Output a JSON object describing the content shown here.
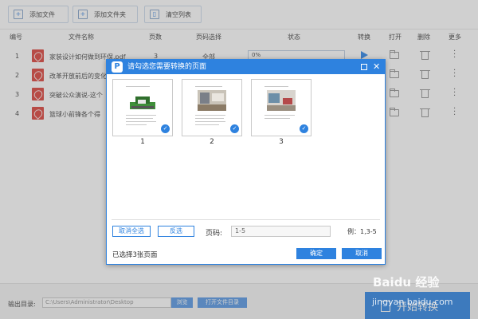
{
  "toolbar": {
    "add_file": "添加文件",
    "add_folder": "添加文件夹",
    "clear_list": "清空列表"
  },
  "table": {
    "headers": {
      "index": "编号",
      "name": "文件名称",
      "pages": "页数",
      "page_select": "页码选择",
      "status": "状态",
      "convert": "转换",
      "open": "打开",
      "delete": "删除",
      "more": "更多"
    },
    "rows": [
      {
        "index": "1",
        "name": "家装设计如何做到环保.pdf",
        "pages": "3",
        "page_select": "全部",
        "status": "0%"
      },
      {
        "index": "2",
        "name": "改革开放前后的变化",
        "pages": "",
        "page_select": "",
        "status": ""
      },
      {
        "index": "3",
        "name": "突破公众演说-这个",
        "pages": "",
        "page_select": "",
        "status": ""
      },
      {
        "index": "4",
        "name": "篮球小前锋各个得",
        "pages": "",
        "page_select": "",
        "status": ""
      }
    ]
  },
  "modal": {
    "title": "请勾选您需要转换的页面",
    "thumbs": [
      "1",
      "2",
      "3"
    ],
    "deselect_all": "取消全选",
    "invert": "反选",
    "pages_label": "页码:",
    "pages_value": "1-5",
    "example": "例：1,3-5",
    "selected_count": "已选择3张页面",
    "ok": "确定",
    "cancel": "取消"
  },
  "bottom": {
    "output_label": "输出目录:",
    "output_path": "C:\\Users\\Administrator\\Desktop",
    "browse": "浏览",
    "open_dir": "打开文件目录",
    "start": "开始转换"
  },
  "watermark": {
    "text": "Baidu 经验",
    "url": "jingyan.baidu.com"
  },
  "colors": {
    "accent": "#2e82df",
    "pdf_red": "#d9342b",
    "start_button": "#1e7be2"
  }
}
